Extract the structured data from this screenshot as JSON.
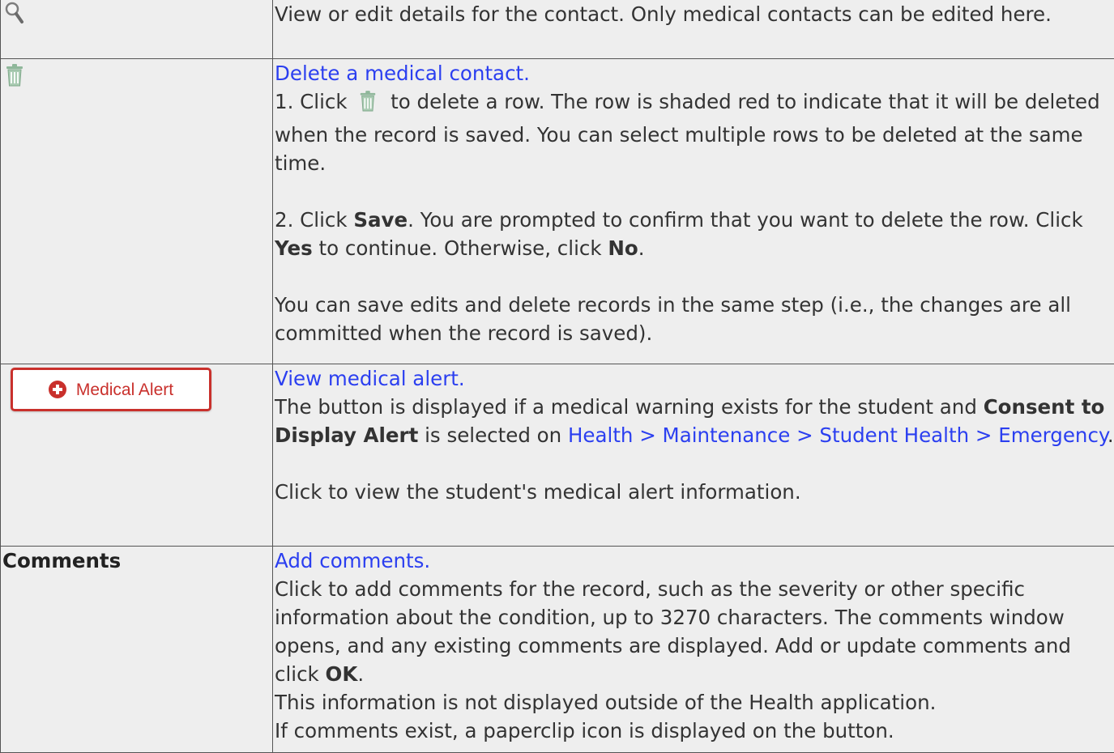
{
  "rows": {
    "magnifier": {
      "icon": "magnifier-icon",
      "description": "View or edit details for the contact. Only medical contacts can be edited here."
    },
    "delete": {
      "icon": "trash-can-icon",
      "link": "Delete a medical contact.",
      "step1_a": "1. Click",
      "step1_b": "to delete a row. The row is shaded red to indicate that it will be deleted when the record is saved. You can select multiple rows to be deleted at the same time.",
      "step2_a": "2. Click",
      "step2_save": "Save",
      "step2_b": ". You are prompted to confirm that you want to delete the row. Click",
      "step2_yes": "Yes",
      "step2_c": "to continue. Otherwise, click",
      "step2_no": "No",
      "step2_d": ".",
      "note": "You can save edits and delete records in the same step (i.e., the changes are all committed when the record is saved)."
    },
    "medical_alert": {
      "button_label": "Medical Alert",
      "button_icon": "plus-circle-icon",
      "link": "View medical alert.",
      "text_a": "The button is displayed if a medical warning exists for the student and",
      "consent": "Consent to Display Alert",
      "text_b": "is selected on",
      "path_link": "Health > Maintenance > Student Health > Emergency",
      "text_c": ".",
      "click_text": "Click to view the student's medical alert information."
    },
    "comments": {
      "label": "Comments",
      "link": "Add comments.",
      "text_a": "Click to add comments for the record, such as the severity or other specific information about the condition, up to 3270 characters. The comments window opens, and any existing comments are displayed. Add or update comments and click",
      "ok": "OK",
      "text_b": ".",
      "line2": "This information is not displayed outside of the Health application.",
      "line3": "If comments exist, a paperclip icon is displayed on the button."
    }
  },
  "colors": {
    "link": "#2b3ff0",
    "cell_bg": "#eeeeee",
    "alert_red": "#c9302c",
    "trash_green": "#8fb79a"
  }
}
